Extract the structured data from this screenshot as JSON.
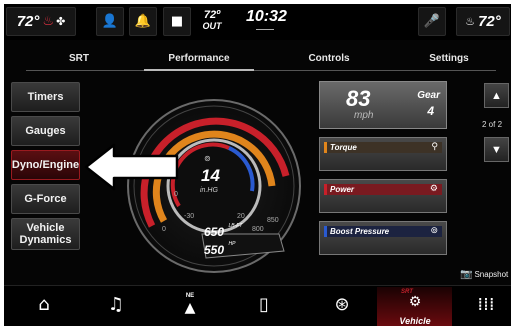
{
  "status_bar": {
    "left_temp": "72°",
    "outside_temp": "72º",
    "outside_label": "OUT",
    "time": "10:32",
    "right_temp": "72°",
    "icons": [
      "seat-heat-icon",
      "fan-icon",
      "person-icon",
      "bell-icon",
      "camera-icon",
      "mic-icon",
      "steering-heat-icon"
    ]
  },
  "tabs": [
    {
      "label": "SRT"
    },
    {
      "label": "Performance",
      "active": true
    },
    {
      "label": "Controls"
    },
    {
      "label": "Settings"
    }
  ],
  "left_menu": [
    {
      "label": "Timers"
    },
    {
      "label": "Gauges"
    },
    {
      "label": "Dyno/Engine",
      "active": true
    },
    {
      "label": "G-Force"
    },
    {
      "label": "Vehicle Dynamics"
    }
  ],
  "gauge": {
    "center_value": "14",
    "center_unit": "in.HG",
    "torque_value": "650",
    "torque_unit": "LB-FT",
    "hp_value": "550",
    "hp_unit": "HP",
    "tick_labels": [
      "-30",
      "0",
      "20",
      "0",
      "800",
      "850"
    ]
  },
  "speed_card": {
    "speed": "83",
    "unit": "mph",
    "gear_label": "Gear",
    "gear": "4"
  },
  "cards": [
    {
      "title": "Torque",
      "color": "#e0851c",
      "bar": "#3d3226",
      "icon": "wrench-icon"
    },
    {
      "title": "Power",
      "color": "#c8202a",
      "bar": "#7a1a20",
      "icon": "engine-icon"
    },
    {
      "title": "Boost Pressure",
      "color": "#2a5ad0",
      "bar": "#1c2340",
      "icon": "turbo-icon"
    }
  ],
  "pager": {
    "text": "2 of 2"
  },
  "snapshot": {
    "label": "Snapshot"
  },
  "bottom_nav": {
    "compass": "NE",
    "vehicle_label": "Vehicle",
    "srt_badge": "SRT",
    "items": [
      "home-icon",
      "music-icon",
      "navigation-icon",
      "phone-icon",
      "climate-icon",
      "vehicle-icon",
      "apps-icon"
    ]
  },
  "colors": {
    "accent_red": "#c8202a",
    "accent_orange": "#e0851c",
    "accent_blue": "#2a5ad0"
  }
}
